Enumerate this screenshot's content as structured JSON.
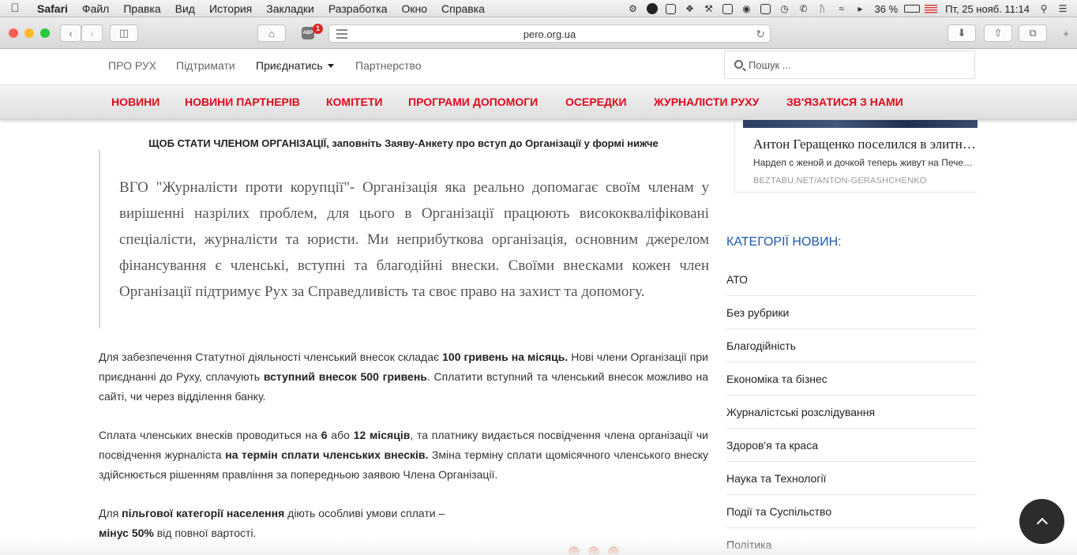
{
  "menubar": {
    "apple_icon": "apple-logo-icon",
    "items": [
      "Safari",
      "Файл",
      "Правка",
      "Вид",
      "История",
      "Закладки",
      "Разработка",
      "Окно",
      "Справка"
    ],
    "battery": "36 %",
    "clock": "Пт, 25 нояб.  11:14"
  },
  "browser": {
    "url": "pero.org.ua",
    "adblock_label": "ABP",
    "adblock_count": "1"
  },
  "topnav": {
    "items": [
      "ПРО РУХ",
      "Підтримати",
      "Приєднатись",
      "Партнерство"
    ],
    "search_placeholder": "Пошук ..."
  },
  "redbar": {
    "items": [
      "НОВИНИ",
      "НОВИНИ ПАРТНЕРІВ",
      "КОМІТЕТИ",
      "ПРОГРАМИ ДОПОМОГИ",
      "ОСЕРЕДКИ",
      "ЖУРНАЛІСТИ РУХУ",
      "ЗВ'ЯЗАТИСЯ З НАМИ"
    ]
  },
  "main": {
    "intro_bold": "ЩОБ СТАТИ ЧЛЕНОМ ОРГАНІЗАЦІЇ",
    "intro_rest": ", заповніть Заяву-Анкету про вступ до Організації у формі нижче",
    "quote": "ВГО \"Журналісти проти корупції\"- Організація яка реально допомагає своїм членам у вирішенні назрілих проблем, для цього в Організації працюють висококваліфіковані спеціалісти, журналісти та юристи. Ми неприбуткова організація, основним джерелом фінансування є членські, вступні та благодійні внески. Своїми внесками кожен член Організації підтримує Рух за Справедливість та своє право на захист та допомогу.",
    "p1": {
      "t1": "Для забезпечення Статутної діяльності членський внесок складає ",
      "b1": "100 гривень на місяць.",
      "t2": " Нові члени Організації при приєднанні до Руху, сплачують ",
      "b2": "вступний внесок 500 гривень",
      "t3": ". Сплатити вступний та членський внесок можливо на сайті, чи через відділення банку."
    },
    "p2": {
      "t1": "Сплата членських внесків проводиться на ",
      "b1": "6",
      "t2": " або ",
      "b2": "12 місяців",
      "t3": ", та платнику видається посвідчення члена організації чи посвідчення журналіста ",
      "b3": "на термін сплати членських внесків.",
      "t4": " Зміна терміну сплати щомісячного членського внеску здійснюється рішенням правління за попередньою заявою Члена Організації."
    },
    "p3": {
      "t1": "Для ",
      "b1": "пільгової категорії населення",
      "t2": " діють особливі умови сплати –",
      "b2": "мінус 50%",
      "t3": " від повної вартості."
    }
  },
  "sidebar": {
    "ad_title": "Антон Геращенко поселился в элитном доме",
    "ad_desc": "Нардеп с женой и дочкой теперь живут на Печерске",
    "ad_source": "BEZTABU.NET/ANTON-GERASHCHENKO",
    "categories_heading": "КАТЕГОРІЇ НОВИН:",
    "categories": [
      "АТО",
      "Без рубрики",
      "Благодійність",
      "Економіка та бізнес",
      "Журналістські розслідування",
      "Здоров'я та краса",
      "Наука та Технології",
      "Події та Суспільство",
      "Політика"
    ]
  },
  "colors": {
    "accent_red": "#e0081c",
    "category_heading_blue": "#1a5ab0",
    "scroll_top_bg": "#2c2c2c"
  }
}
